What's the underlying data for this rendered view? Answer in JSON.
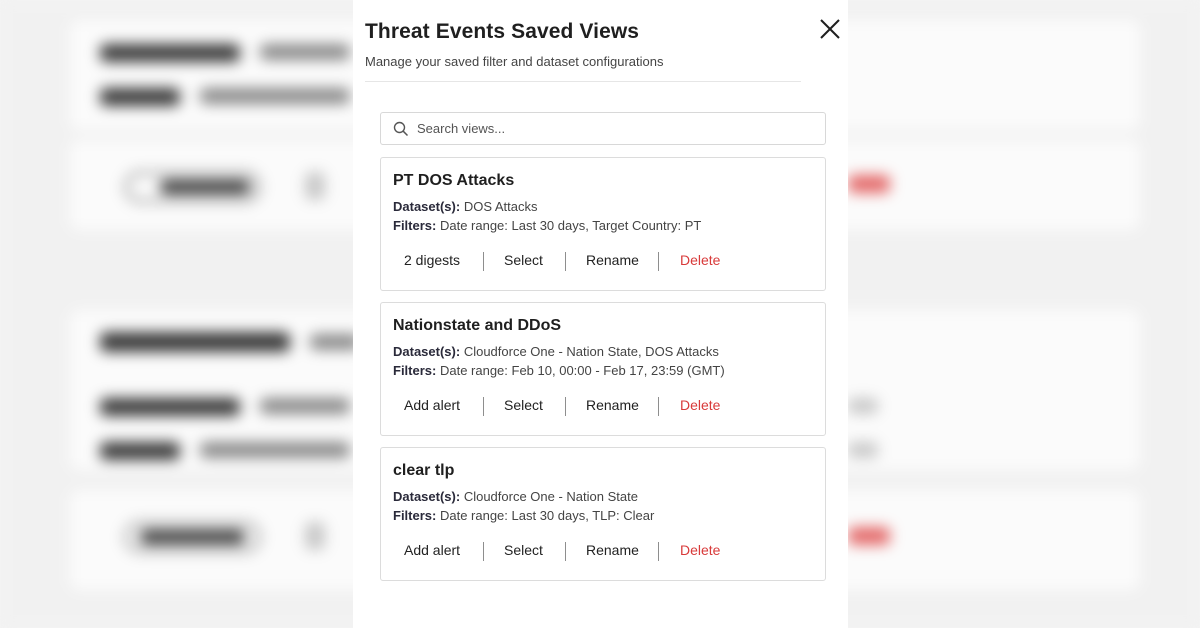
{
  "modal": {
    "title": "Threat Events Saved Views",
    "subtitle": "Manage your saved filter and dataset configurations",
    "close_icon": "close-icon"
  },
  "search": {
    "placeholder": "Search views...",
    "icon": "search-icon"
  },
  "views": [
    {
      "name": "PT DOS Attacks",
      "dataset_label": "Dataset(s):",
      "dataset": "DOS Attacks",
      "filters_label": "Filters:",
      "filters": "Date range: Last 30 days, Target Country: PT",
      "primary_action": "2 digests",
      "select": "Select",
      "rename": "Rename",
      "delete": "Delete"
    },
    {
      "name": "Nationstate and DDoS",
      "dataset_label": "Dataset(s):",
      "dataset": "Cloudforce One - Nation State, DOS Attacks",
      "filters_label": "Filters:",
      "filters": "Date range: Feb 10, 00:00 - Feb 17, 23:59 (GMT)",
      "primary_action": "Add alert",
      "select": "Select",
      "rename": "Rename",
      "delete": "Delete"
    },
    {
      "name": "clear tlp",
      "dataset_label": "Dataset(s):",
      "dataset": "Cloudforce One - Nation State",
      "filters_label": "Filters:",
      "filters": "Date range: Last 30 days, TLP: Clear",
      "primary_action": "Add alert",
      "select": "Select",
      "rename": "Rename",
      "delete": "Delete"
    }
  ],
  "colors": {
    "delete": "#d83a3a",
    "panel_bg": "#ffffff",
    "backdrop": "#f4f4f4"
  }
}
